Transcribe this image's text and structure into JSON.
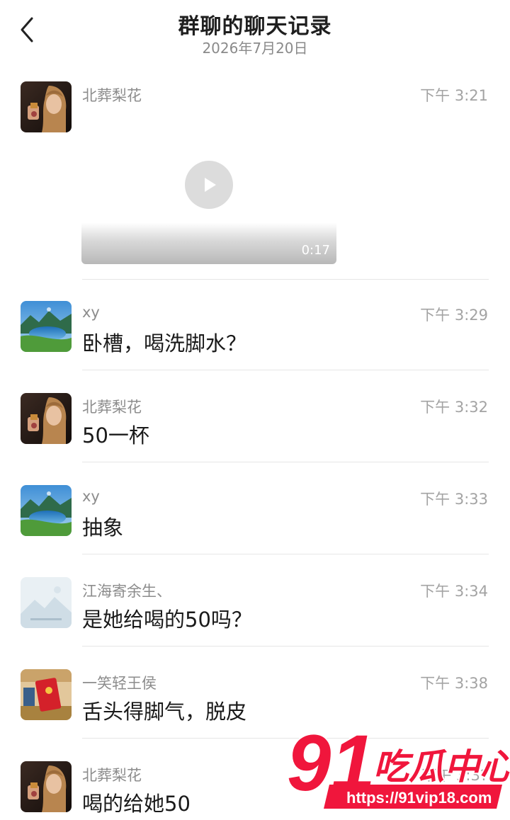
{
  "header": {
    "title": "群聊的聊天记录",
    "date": "2026年7月20日",
    "back_icon": "chevron-left-icon"
  },
  "messages": [
    {
      "sender": "北葬梨花",
      "time": "下午 3:21",
      "type": "video",
      "duration": "0:17",
      "avatar": "portrait-woman"
    },
    {
      "sender": "xy",
      "time": "下午 3:29",
      "text": "卧槽，喝洗脚水？",
      "avatar": "lake-landscape"
    },
    {
      "sender": "北葬梨花",
      "time": "下午 3:32",
      "text": "50一杯",
      "avatar": "portrait-woman"
    },
    {
      "sender": "xy",
      "time": "下午 3:33",
      "text": "抽象",
      "avatar": "lake-landscape"
    },
    {
      "sender": "江海寄余生、",
      "time": "下午 3:34",
      "text": "是她给喝的50吗？",
      "avatar": "placeholder-mountains"
    },
    {
      "sender": "一笑轻王侯",
      "time": "下午 3:38",
      "text": "舌头得脚气，脱皮",
      "avatar": "red-envelope"
    },
    {
      "sender": "北葬梨花",
      "time": "下午 3:3?",
      "text": "喝的给她50",
      "avatar": "portrait-woman"
    }
  ],
  "watermark": {
    "logo_number": "91",
    "logo_text": "吃瓜中心",
    "url": "https://91vip18.com"
  },
  "colors": {
    "sender": "#8c8c8c",
    "time": "#a3a3a3",
    "divider": "#e6e6e6",
    "watermark_red": "#f0163c"
  }
}
